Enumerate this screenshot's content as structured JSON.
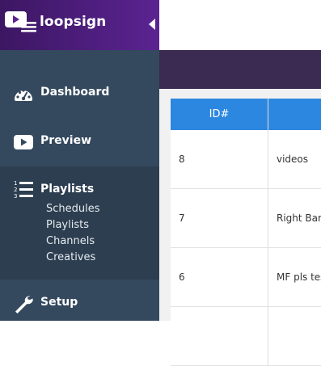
{
  "app": {
    "brand": "loopsign",
    "collapse_icon": "chevron-left-icon"
  },
  "colors": {
    "brand_gradient_start": "#3c1763",
    "brand_gradient_end": "#5b2391",
    "sidebar": "#34495e",
    "accent_header": "#2c87e0",
    "purple_bar": "#3b2a52"
  },
  "nav": {
    "dashboard": {
      "label": "Dashboard",
      "icon": "speedometer-icon"
    },
    "preview": {
      "label": "Preview",
      "icon": "play-icon"
    },
    "playlists": {
      "label": "Playlists",
      "icon": "numbered-list-icon"
    },
    "setup": {
      "label": "Setup",
      "icon": "wrench-icon"
    }
  },
  "submenu": [
    "Schedules",
    "Playlists",
    "Channels",
    "Creatives"
  ],
  "table": {
    "headers": [
      "ID#",
      ""
    ],
    "rows": [
      [
        "8",
        "videos"
      ],
      [
        "7",
        "Right Ban"
      ],
      [
        "6",
        "MF pls tes"
      ],
      [
        "",
        ""
      ]
    ]
  }
}
